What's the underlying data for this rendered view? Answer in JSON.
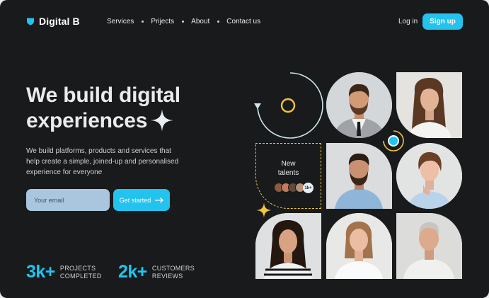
{
  "brand": {
    "name": "Digital B"
  },
  "nav": {
    "items": [
      "Services",
      "Prijects",
      "About",
      "Contact us"
    ]
  },
  "auth": {
    "login_label": "Log in",
    "signup_label": "Sign up"
  },
  "hero": {
    "title_line1": "We build digital",
    "title_line2": "experiences",
    "subtitle": "We build platforms, products and services that help create a simple, joined-up and personalised experience for everyone",
    "email_placeholder": "Your email",
    "cta_label": "Get started"
  },
  "stats": [
    {
      "value": "3k+",
      "line1": "PROJECTS",
      "line2": "COMPLETED"
    },
    {
      "value": "2k+",
      "line1": "CUSTOMERS",
      "line2": "REVIEWS"
    }
  ],
  "talents": {
    "line1": "New",
    "line2": "talents",
    "more": "1k+"
  },
  "colors": {
    "accent": "#22c3ef",
    "background": "#181a1b",
    "yellow": "#f2c53d",
    "input": "#a9c6de"
  }
}
